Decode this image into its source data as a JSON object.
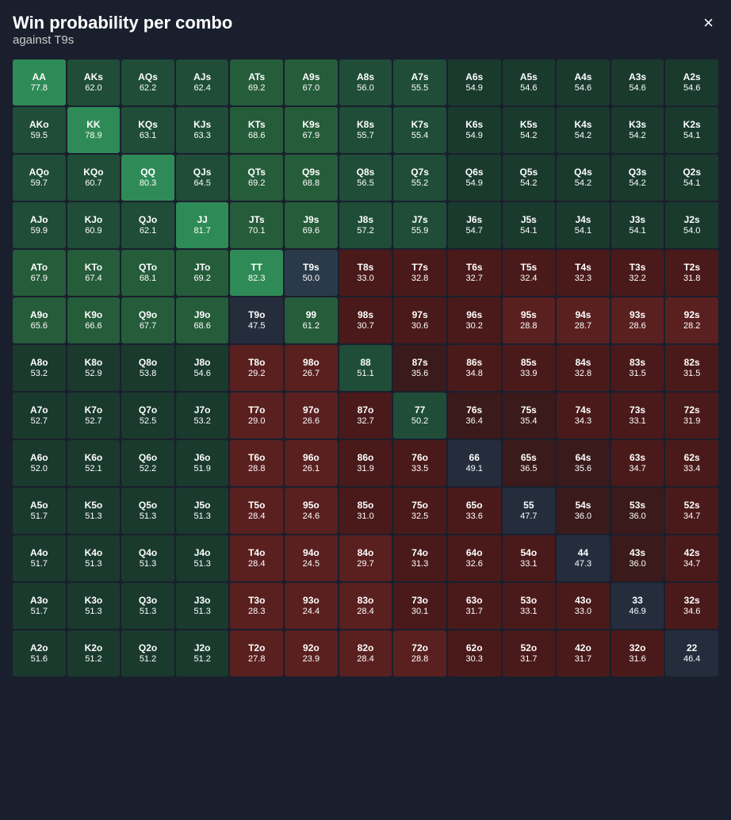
{
  "header": {
    "title": "Win probability per combo",
    "subtitle": "against T9s",
    "close_label": "×"
  },
  "grid": {
    "cells": [
      {
        "hand": "AA",
        "prob": "77.8",
        "color": "bright-green"
      },
      {
        "hand": "AKs",
        "prob": "62.0",
        "color": "green-dark"
      },
      {
        "hand": "AQs",
        "prob": "62.2",
        "color": "green-dark"
      },
      {
        "hand": "AJs",
        "prob": "62.4",
        "color": "green-dark"
      },
      {
        "hand": "ATs",
        "prob": "69.2",
        "color": "green-dark"
      },
      {
        "hand": "A9s",
        "prob": "67.0",
        "color": "green-dark"
      },
      {
        "hand": "A8s",
        "prob": "56.0",
        "color": "teal-dark"
      },
      {
        "hand": "A7s",
        "prob": "55.5",
        "color": "teal-dark"
      },
      {
        "hand": "A6s",
        "prob": "54.9",
        "color": "teal-dark"
      },
      {
        "hand": "A5s",
        "prob": "54.6",
        "color": "teal-dark"
      },
      {
        "hand": "A4s",
        "prob": "54.6",
        "color": "teal-dark"
      },
      {
        "hand": "A3s",
        "prob": "54.6",
        "color": "teal-dark"
      },
      {
        "hand": "A2s",
        "prob": "54.6",
        "color": "teal-dark"
      },
      {
        "hand": "AKo",
        "prob": "59.5",
        "color": "green-dark"
      },
      {
        "hand": "KK",
        "prob": "78.9",
        "color": "bright-green"
      },
      {
        "hand": "KQs",
        "prob": "63.1",
        "color": "green-dark"
      },
      {
        "hand": "KJs",
        "prob": "63.3",
        "color": "green-dark"
      },
      {
        "hand": "KTs",
        "prob": "68.6",
        "color": "green-dark"
      },
      {
        "hand": "K9s",
        "prob": "67.9",
        "color": "green-dark"
      },
      {
        "hand": "K8s",
        "prob": "55.7",
        "color": "teal-dark"
      },
      {
        "hand": "K7s",
        "prob": "55.4",
        "color": "teal-dark"
      },
      {
        "hand": "K6s",
        "prob": "54.9",
        "color": "teal-dark"
      },
      {
        "hand": "K5s",
        "prob": "54.2",
        "color": "teal-dark"
      },
      {
        "hand": "K4s",
        "prob": "54.2",
        "color": "teal-dark"
      },
      {
        "hand": "K3s",
        "prob": "54.2",
        "color": "teal-dark"
      },
      {
        "hand": "K2s",
        "prob": "54.1",
        "color": "teal-dark"
      },
      {
        "hand": "AQo",
        "prob": "59.7",
        "color": "green-dark"
      },
      {
        "hand": "KQo",
        "prob": "60.7",
        "color": "green-dark"
      },
      {
        "hand": "QQ",
        "prob": "80.3",
        "color": "bright-green"
      },
      {
        "hand": "QJs",
        "prob": "64.5",
        "color": "green-dark"
      },
      {
        "hand": "QTs",
        "prob": "69.2",
        "color": "green-dark"
      },
      {
        "hand": "Q9s",
        "prob": "68.8",
        "color": "green-dark"
      },
      {
        "hand": "Q8s",
        "prob": "56.5",
        "color": "teal-dark"
      },
      {
        "hand": "Q7s",
        "prob": "55.2",
        "color": "teal-dark"
      },
      {
        "hand": "Q6s",
        "prob": "54.9",
        "color": "teal-dark"
      },
      {
        "hand": "Q5s",
        "prob": "54.2",
        "color": "teal-dark"
      },
      {
        "hand": "Q4s",
        "prob": "54.2",
        "color": "teal-dark"
      },
      {
        "hand": "Q3s",
        "prob": "54.2",
        "color": "teal-dark"
      },
      {
        "hand": "Q2s",
        "prob": "54.1",
        "color": "teal-dark"
      },
      {
        "hand": "AJo",
        "prob": "59.9",
        "color": "green-dark"
      },
      {
        "hand": "KJo",
        "prob": "60.9",
        "color": "green-dark"
      },
      {
        "hand": "QJo",
        "prob": "62.1",
        "color": "green-dark"
      },
      {
        "hand": "JJ",
        "prob": "81.7",
        "color": "bright-green"
      },
      {
        "hand": "JTs",
        "prob": "70.1",
        "color": "green-dark"
      },
      {
        "hand": "J9s",
        "prob": "69.6",
        "color": "green-dark"
      },
      {
        "hand": "J8s",
        "prob": "57.2",
        "color": "teal-dark"
      },
      {
        "hand": "J7s",
        "prob": "55.9",
        "color": "teal-dark"
      },
      {
        "hand": "J6s",
        "prob": "54.7",
        "color": "teal-dark"
      },
      {
        "hand": "J5s",
        "prob": "54.1",
        "color": "teal-dark"
      },
      {
        "hand": "J4s",
        "prob": "54.1",
        "color": "teal-dark"
      },
      {
        "hand": "J3s",
        "prob": "54.1",
        "color": "teal-dark"
      },
      {
        "hand": "J2s",
        "prob": "54.0",
        "color": "teal-dark"
      },
      {
        "hand": "ATo",
        "prob": "67.9",
        "color": "green-dark"
      },
      {
        "hand": "KTo",
        "prob": "67.4",
        "color": "green-dark"
      },
      {
        "hand": "QTo",
        "prob": "68.1",
        "color": "green-dark"
      },
      {
        "hand": "JTo",
        "prob": "69.2",
        "color": "green-dark"
      },
      {
        "hand": "TT",
        "prob": "82.3",
        "color": "bright-green"
      },
      {
        "hand": "T9s",
        "prob": "50.0",
        "color": "dark-bg"
      },
      {
        "hand": "T8s",
        "prob": "33.0",
        "color": "red-dark"
      },
      {
        "hand": "T7s",
        "prob": "32.8",
        "color": "red-dark"
      },
      {
        "hand": "T6s",
        "prob": "32.7",
        "color": "red-dark"
      },
      {
        "hand": "T5s",
        "prob": "32.4",
        "color": "red-dark"
      },
      {
        "hand": "T4s",
        "prob": "32.3",
        "color": "red-dark"
      },
      {
        "hand": "T3s",
        "prob": "32.2",
        "color": "red-dark"
      },
      {
        "hand": "T2s",
        "prob": "31.8",
        "color": "red-dark"
      },
      {
        "hand": "A9o",
        "prob": "65.6",
        "color": "green-dark"
      },
      {
        "hand": "K9o",
        "prob": "66.6",
        "color": "green-dark"
      },
      {
        "hand": "Q9o",
        "prob": "67.7",
        "color": "green-dark"
      },
      {
        "hand": "J9o",
        "prob": "68.6",
        "color": "green-dark"
      },
      {
        "hand": "T9o",
        "prob": "47.5",
        "color": "dark-bg"
      },
      {
        "hand": "99",
        "prob": "61.2",
        "color": "green-dark"
      },
      {
        "hand": "98s",
        "prob": "30.7",
        "color": "red-dark"
      },
      {
        "hand": "97s",
        "prob": "30.6",
        "color": "red-dark"
      },
      {
        "hand": "96s",
        "prob": "30.2",
        "color": "red-dark"
      },
      {
        "hand": "95s",
        "prob": "28.8",
        "color": "red-dark"
      },
      {
        "hand": "94s",
        "prob": "28.7",
        "color": "red-dark"
      },
      {
        "hand": "93s",
        "prob": "28.6",
        "color": "red-dark"
      },
      {
        "hand": "92s",
        "prob": "28.2",
        "color": "red-dark"
      },
      {
        "hand": "A8o",
        "prob": "53.2",
        "color": "teal-dark"
      },
      {
        "hand": "K8o",
        "prob": "52.9",
        "color": "teal-dark"
      },
      {
        "hand": "Q8o",
        "prob": "53.8",
        "color": "teal-dark"
      },
      {
        "hand": "J8o",
        "prob": "54.6",
        "color": "teal-dark"
      },
      {
        "hand": "T8o",
        "prob": "29.2",
        "color": "red-dark"
      },
      {
        "hand": "98o",
        "prob": "26.7",
        "color": "red-dark"
      },
      {
        "hand": "88",
        "prob": "51.1",
        "color": "teal-dark"
      },
      {
        "hand": "87s",
        "prob": "35.6",
        "color": "red-dark"
      },
      {
        "hand": "86s",
        "prob": "34.8",
        "color": "red-dark"
      },
      {
        "hand": "85s",
        "prob": "33.9",
        "color": "red-dark"
      },
      {
        "hand": "84s",
        "prob": "32.8",
        "color": "red-dark"
      },
      {
        "hand": "83s",
        "prob": "31.5",
        "color": "red-dark"
      },
      {
        "hand": "82s",
        "prob": "31.5",
        "color": "red-dark"
      },
      {
        "hand": "A7o",
        "prob": "52.7",
        "color": "teal-dark"
      },
      {
        "hand": "K7o",
        "prob": "52.7",
        "color": "teal-dark"
      },
      {
        "hand": "Q7o",
        "prob": "52.5",
        "color": "teal-dark"
      },
      {
        "hand": "J7o",
        "prob": "53.2",
        "color": "teal-dark"
      },
      {
        "hand": "T7o",
        "prob": "29.0",
        "color": "red-dark"
      },
      {
        "hand": "97o",
        "prob": "26.6",
        "color": "red-dark"
      },
      {
        "hand": "87o",
        "prob": "32.7",
        "color": "red-dark"
      },
      {
        "hand": "77",
        "prob": "50.2",
        "color": "teal-dark"
      },
      {
        "hand": "76s",
        "prob": "36.4",
        "color": "red-dark"
      },
      {
        "hand": "75s",
        "prob": "35.4",
        "color": "red-dark"
      },
      {
        "hand": "74s",
        "prob": "34.3",
        "color": "red-dark"
      },
      {
        "hand": "73s",
        "prob": "33.1",
        "color": "red-dark"
      },
      {
        "hand": "72s",
        "prob": "31.9",
        "color": "red-dark"
      },
      {
        "hand": "A6o",
        "prob": "52.0",
        "color": "teal-dark"
      },
      {
        "hand": "K6o",
        "prob": "52.1",
        "color": "teal-dark"
      },
      {
        "hand": "Q6o",
        "prob": "52.2",
        "color": "teal-dark"
      },
      {
        "hand": "J6o",
        "prob": "51.9",
        "color": "teal-dark"
      },
      {
        "hand": "T6o",
        "prob": "28.8",
        "color": "red-dark"
      },
      {
        "hand": "96o",
        "prob": "26.1",
        "color": "red-dark"
      },
      {
        "hand": "86o",
        "prob": "31.9",
        "color": "red-dark"
      },
      {
        "hand": "76o",
        "prob": "33.5",
        "color": "red-dark"
      },
      {
        "hand": "66",
        "prob": "49.1",
        "color": "dark-bg"
      },
      {
        "hand": "65s",
        "prob": "36.5",
        "color": "red-dark"
      },
      {
        "hand": "64s",
        "prob": "35.6",
        "color": "red-dark"
      },
      {
        "hand": "63s",
        "prob": "34.7",
        "color": "red-dark"
      },
      {
        "hand": "62s",
        "prob": "33.4",
        "color": "red-dark"
      },
      {
        "hand": "A5o",
        "prob": "51.7",
        "color": "teal-dark"
      },
      {
        "hand": "K5o",
        "prob": "51.3",
        "color": "teal-dark"
      },
      {
        "hand": "Q5o",
        "prob": "51.3",
        "color": "teal-dark"
      },
      {
        "hand": "J5o",
        "prob": "51.3",
        "color": "teal-dark"
      },
      {
        "hand": "T5o",
        "prob": "28.4",
        "color": "red-dark"
      },
      {
        "hand": "95o",
        "prob": "24.6",
        "color": "red-dark"
      },
      {
        "hand": "85o",
        "prob": "31.0",
        "color": "red-dark"
      },
      {
        "hand": "75o",
        "prob": "32.5",
        "color": "red-dark"
      },
      {
        "hand": "65o",
        "prob": "33.6",
        "color": "red-dark"
      },
      {
        "hand": "55",
        "prob": "47.7",
        "color": "dark-bg"
      },
      {
        "hand": "54s",
        "prob": "36.0",
        "color": "red-dark"
      },
      {
        "hand": "53s",
        "prob": "36.0",
        "color": "red-dark"
      },
      {
        "hand": "52s",
        "prob": "34.7",
        "color": "red-dark"
      },
      {
        "hand": "A4o",
        "prob": "51.7",
        "color": "teal-dark"
      },
      {
        "hand": "K4o",
        "prob": "51.3",
        "color": "teal-dark"
      },
      {
        "hand": "Q4o",
        "prob": "51.3",
        "color": "teal-dark"
      },
      {
        "hand": "J4o",
        "prob": "51.3",
        "color": "teal-dark"
      },
      {
        "hand": "T4o",
        "prob": "28.4",
        "color": "red-dark"
      },
      {
        "hand": "94o",
        "prob": "24.5",
        "color": "red-dark"
      },
      {
        "hand": "84o",
        "prob": "29.7",
        "color": "red-dark"
      },
      {
        "hand": "74o",
        "prob": "31.3",
        "color": "red-dark"
      },
      {
        "hand": "64o",
        "prob": "32.6",
        "color": "red-dark"
      },
      {
        "hand": "54o",
        "prob": "33.1",
        "color": "red-dark"
      },
      {
        "hand": "44",
        "prob": "47.3",
        "color": "dark-bg"
      },
      {
        "hand": "43s",
        "prob": "36.0",
        "color": "red-dark"
      },
      {
        "hand": "42s",
        "prob": "34.7",
        "color": "red-dark"
      },
      {
        "hand": "A3o",
        "prob": "51.7",
        "color": "teal-dark"
      },
      {
        "hand": "K3o",
        "prob": "51.3",
        "color": "teal-dark"
      },
      {
        "hand": "Q3o",
        "prob": "51.3",
        "color": "teal-dark"
      },
      {
        "hand": "J3o",
        "prob": "51.3",
        "color": "teal-dark"
      },
      {
        "hand": "T3o",
        "prob": "28.3",
        "color": "red-dark"
      },
      {
        "hand": "93o",
        "prob": "24.4",
        "color": "red-dark"
      },
      {
        "hand": "83o",
        "prob": "28.4",
        "color": "red-dark"
      },
      {
        "hand": "73o",
        "prob": "30.1",
        "color": "red-dark"
      },
      {
        "hand": "63o",
        "prob": "31.7",
        "color": "red-dark"
      },
      {
        "hand": "53o",
        "prob": "33.1",
        "color": "red-dark"
      },
      {
        "hand": "43o",
        "prob": "33.0",
        "color": "red-dark"
      },
      {
        "hand": "33",
        "prob": "46.9",
        "color": "dark-bg"
      },
      {
        "hand": "32s",
        "prob": "34.6",
        "color": "red-dark"
      },
      {
        "hand": "A2o",
        "prob": "51.6",
        "color": "teal-dark"
      },
      {
        "hand": "K2o",
        "prob": "51.2",
        "color": "teal-dark"
      },
      {
        "hand": "Q2o",
        "prob": "51.2",
        "color": "teal-dark"
      },
      {
        "hand": "J2o",
        "prob": "51.2",
        "color": "teal-dark"
      },
      {
        "hand": "T2o",
        "prob": "27.8",
        "color": "red-dark"
      },
      {
        "hand": "92o",
        "prob": "23.9",
        "color": "red-dark"
      },
      {
        "hand": "82o",
        "prob": "28.4",
        "color": "red-dark"
      },
      {
        "hand": "72o",
        "prob": "28.8",
        "color": "red-dark"
      },
      {
        "hand": "62o",
        "prob": "30.3",
        "color": "red-dark"
      },
      {
        "hand": "52o",
        "prob": "31.7",
        "color": "red-dark"
      },
      {
        "hand": "42o",
        "prob": "31.7",
        "color": "red-dark"
      },
      {
        "hand": "32o",
        "prob": "31.6",
        "color": "red-dark"
      },
      {
        "hand": "22",
        "prob": "46.4",
        "color": "dark-bg"
      }
    ]
  }
}
